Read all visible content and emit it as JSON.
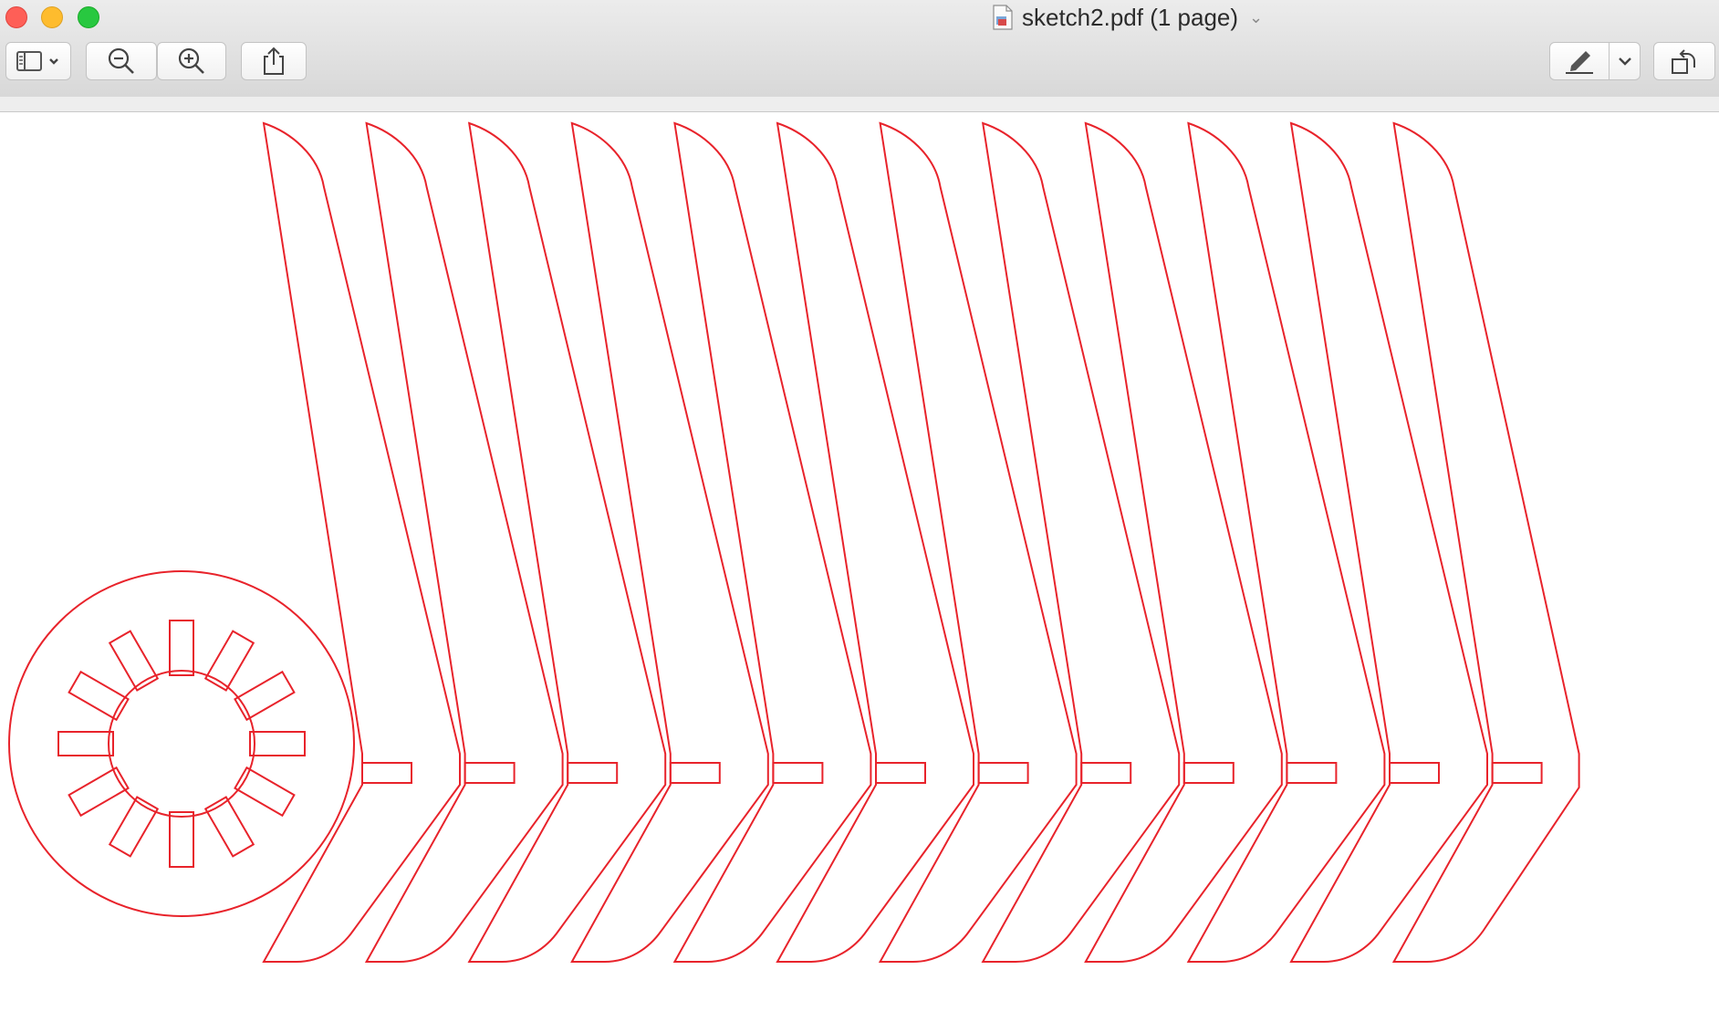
{
  "window": {
    "title": "sketch2.pdf (1 page)",
    "title_chevron": "⌄"
  },
  "toolbar": {
    "sidebar_icon": "sidebar-icon",
    "zoom_out_icon": "zoom-out-icon",
    "zoom_in_icon": "zoom-in-icon",
    "share_icon": "share-icon",
    "markup_icon": "markup-pen-icon",
    "rotate_icon": "rotate-icon"
  },
  "drawing": {
    "stroke_color": "#e8232b",
    "blade_count": 12,
    "hub_spoke_count": 12
  }
}
